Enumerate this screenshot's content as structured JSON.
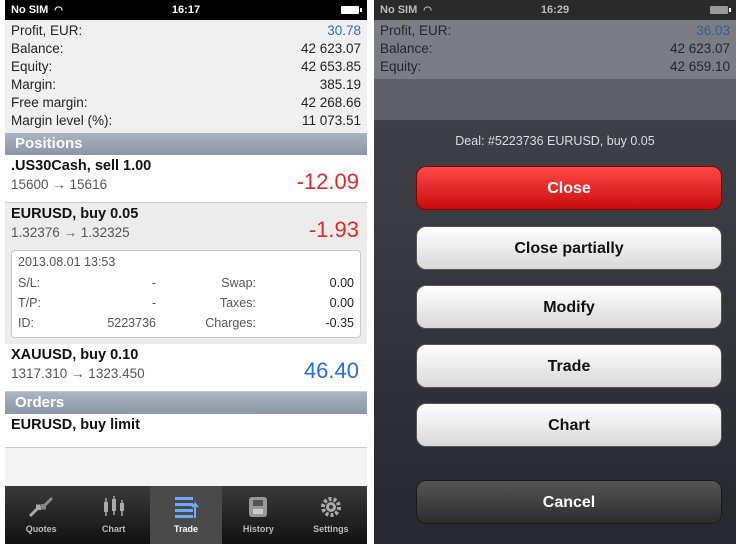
{
  "left": {
    "status": {
      "carrier": "No SIM",
      "time": "16:17"
    },
    "summary": [
      {
        "label": "Profit, EUR:",
        "value": "30.78"
      },
      {
        "label": "Balance:",
        "value": "42 623.07"
      },
      {
        "label": "Equity:",
        "value": "42 653.85"
      },
      {
        "label": "Margin:",
        "value": "385.19"
      },
      {
        "label": "Free margin:",
        "value": "42 268.66"
      },
      {
        "label": "Margin level (%):",
        "value": "11 073.51"
      }
    ],
    "positions_header": "Positions",
    "positions": [
      {
        "title": ".US30Cash, sell 1.00",
        "prices": "15600 → 15616",
        "profit": "-12.09"
      },
      {
        "title": "EURUSD, buy 0.05",
        "prices": "1.32376 → 1.32325",
        "profit": "-1.93"
      },
      {
        "title": "XAUUSD, buy 0.10",
        "prices": "1317.310 → 1323.450",
        "profit": "46.40"
      }
    ],
    "detail": {
      "date": "2013.08.01 13:53",
      "sl_label": "S/L:",
      "sl_value": "-",
      "swap_label": "Swap:",
      "swap_value": "0.00",
      "tp_label": "T/P:",
      "tp_value": "-",
      "taxes_label": "Taxes:",
      "taxes_value": "0.00",
      "id_label": "ID:",
      "id_value": "5223736",
      "charges_label": "Charges:",
      "charges_value": "-0.35"
    },
    "orders_header": "Orders",
    "order_partial": "EURUSD, buy limit",
    "tabs": [
      {
        "label": "Quotes",
        "icon": "quotes-icon"
      },
      {
        "label": "Chart",
        "icon": "chart-icon"
      },
      {
        "label": "Trade",
        "icon": "trade-icon"
      },
      {
        "label": "History",
        "icon": "history-icon"
      },
      {
        "label": "Settings",
        "icon": "settings-icon"
      }
    ]
  },
  "right": {
    "status": {
      "carrier": "No SIM",
      "time": "16:29"
    },
    "summary": [
      {
        "label": "Profit, EUR:",
        "value": "36.03"
      },
      {
        "label": "Balance:",
        "value": "42 623.07"
      },
      {
        "label": "Equity:",
        "value": "42 659.10"
      }
    ],
    "sheet_title": "Deal: #5223736 EURUSD, buy 0.05",
    "buttons": {
      "close": "Close",
      "close_partially": "Close partially",
      "modify": "Modify",
      "trade": "Trade",
      "chart": "Chart",
      "cancel": "Cancel"
    }
  },
  "colors": {
    "accent": "#2a6ecf",
    "negative": "#e02828",
    "close_button": "#e01b1b"
  }
}
